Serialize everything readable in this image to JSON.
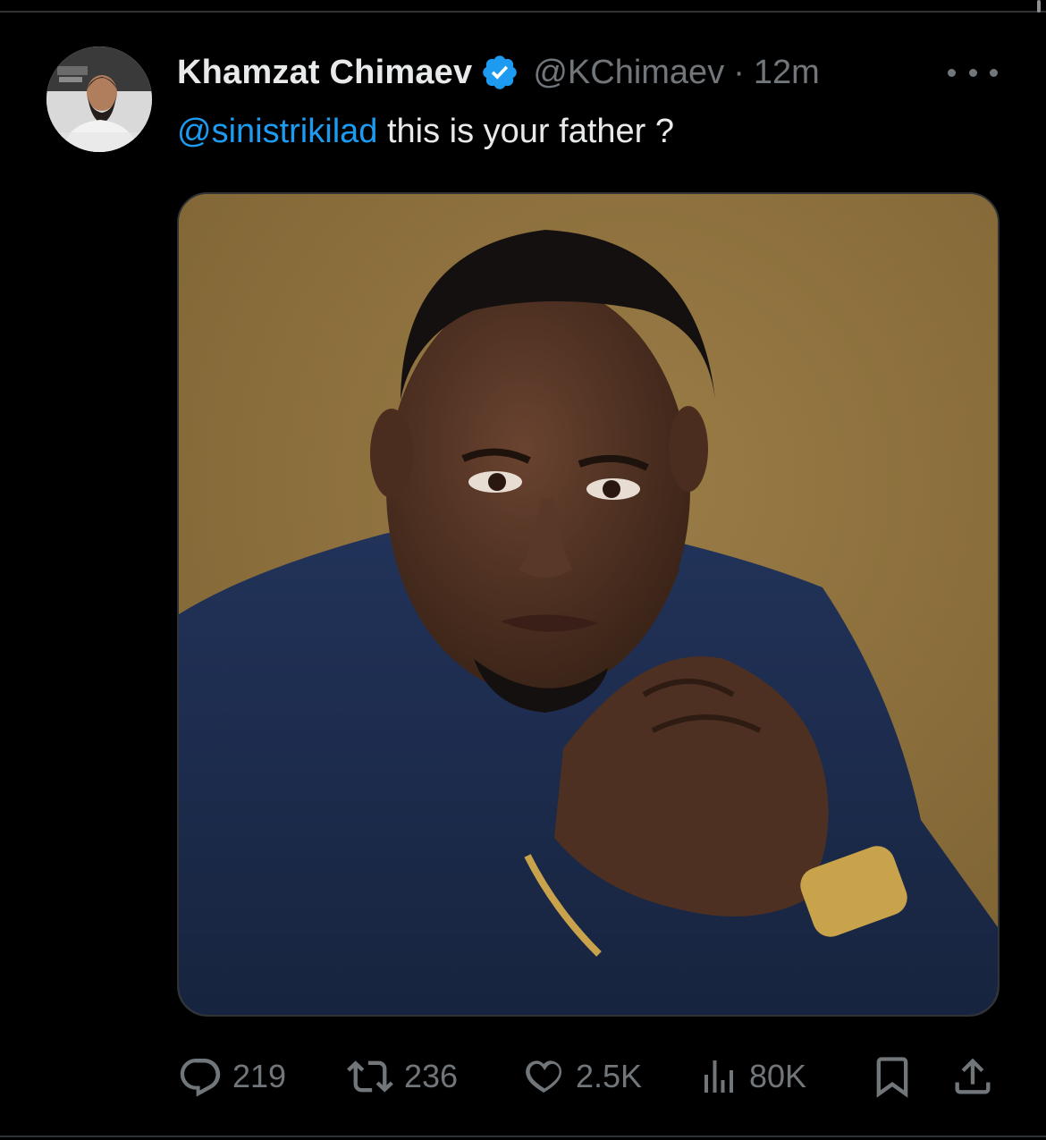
{
  "tweet": {
    "author": {
      "display_name": "Khamzat Chimaev",
      "handle": "@KChimaev",
      "verified": true
    },
    "separator": "·",
    "time": "12m",
    "text": {
      "mention": "@sinistrikilad",
      "body": " this is your father ?"
    },
    "stats": {
      "replies": "219",
      "reposts": "236",
      "likes": "2.5K",
      "views": "80K"
    }
  },
  "icons": {
    "more": "more-horizontal-icon",
    "reply": "reply-bubble-icon",
    "repost": "repost-arrows-icon",
    "like": "heart-icon",
    "views": "bar-chart-icon",
    "bookmark": "bookmark-icon",
    "share": "share-upload-icon",
    "verified": "verified-badge-icon"
  },
  "colors": {
    "background": "#000000",
    "text_primary": "#e7e9ea",
    "text_secondary": "#71767b",
    "accent": "#1d9bf0",
    "divider": "#2f3336"
  }
}
